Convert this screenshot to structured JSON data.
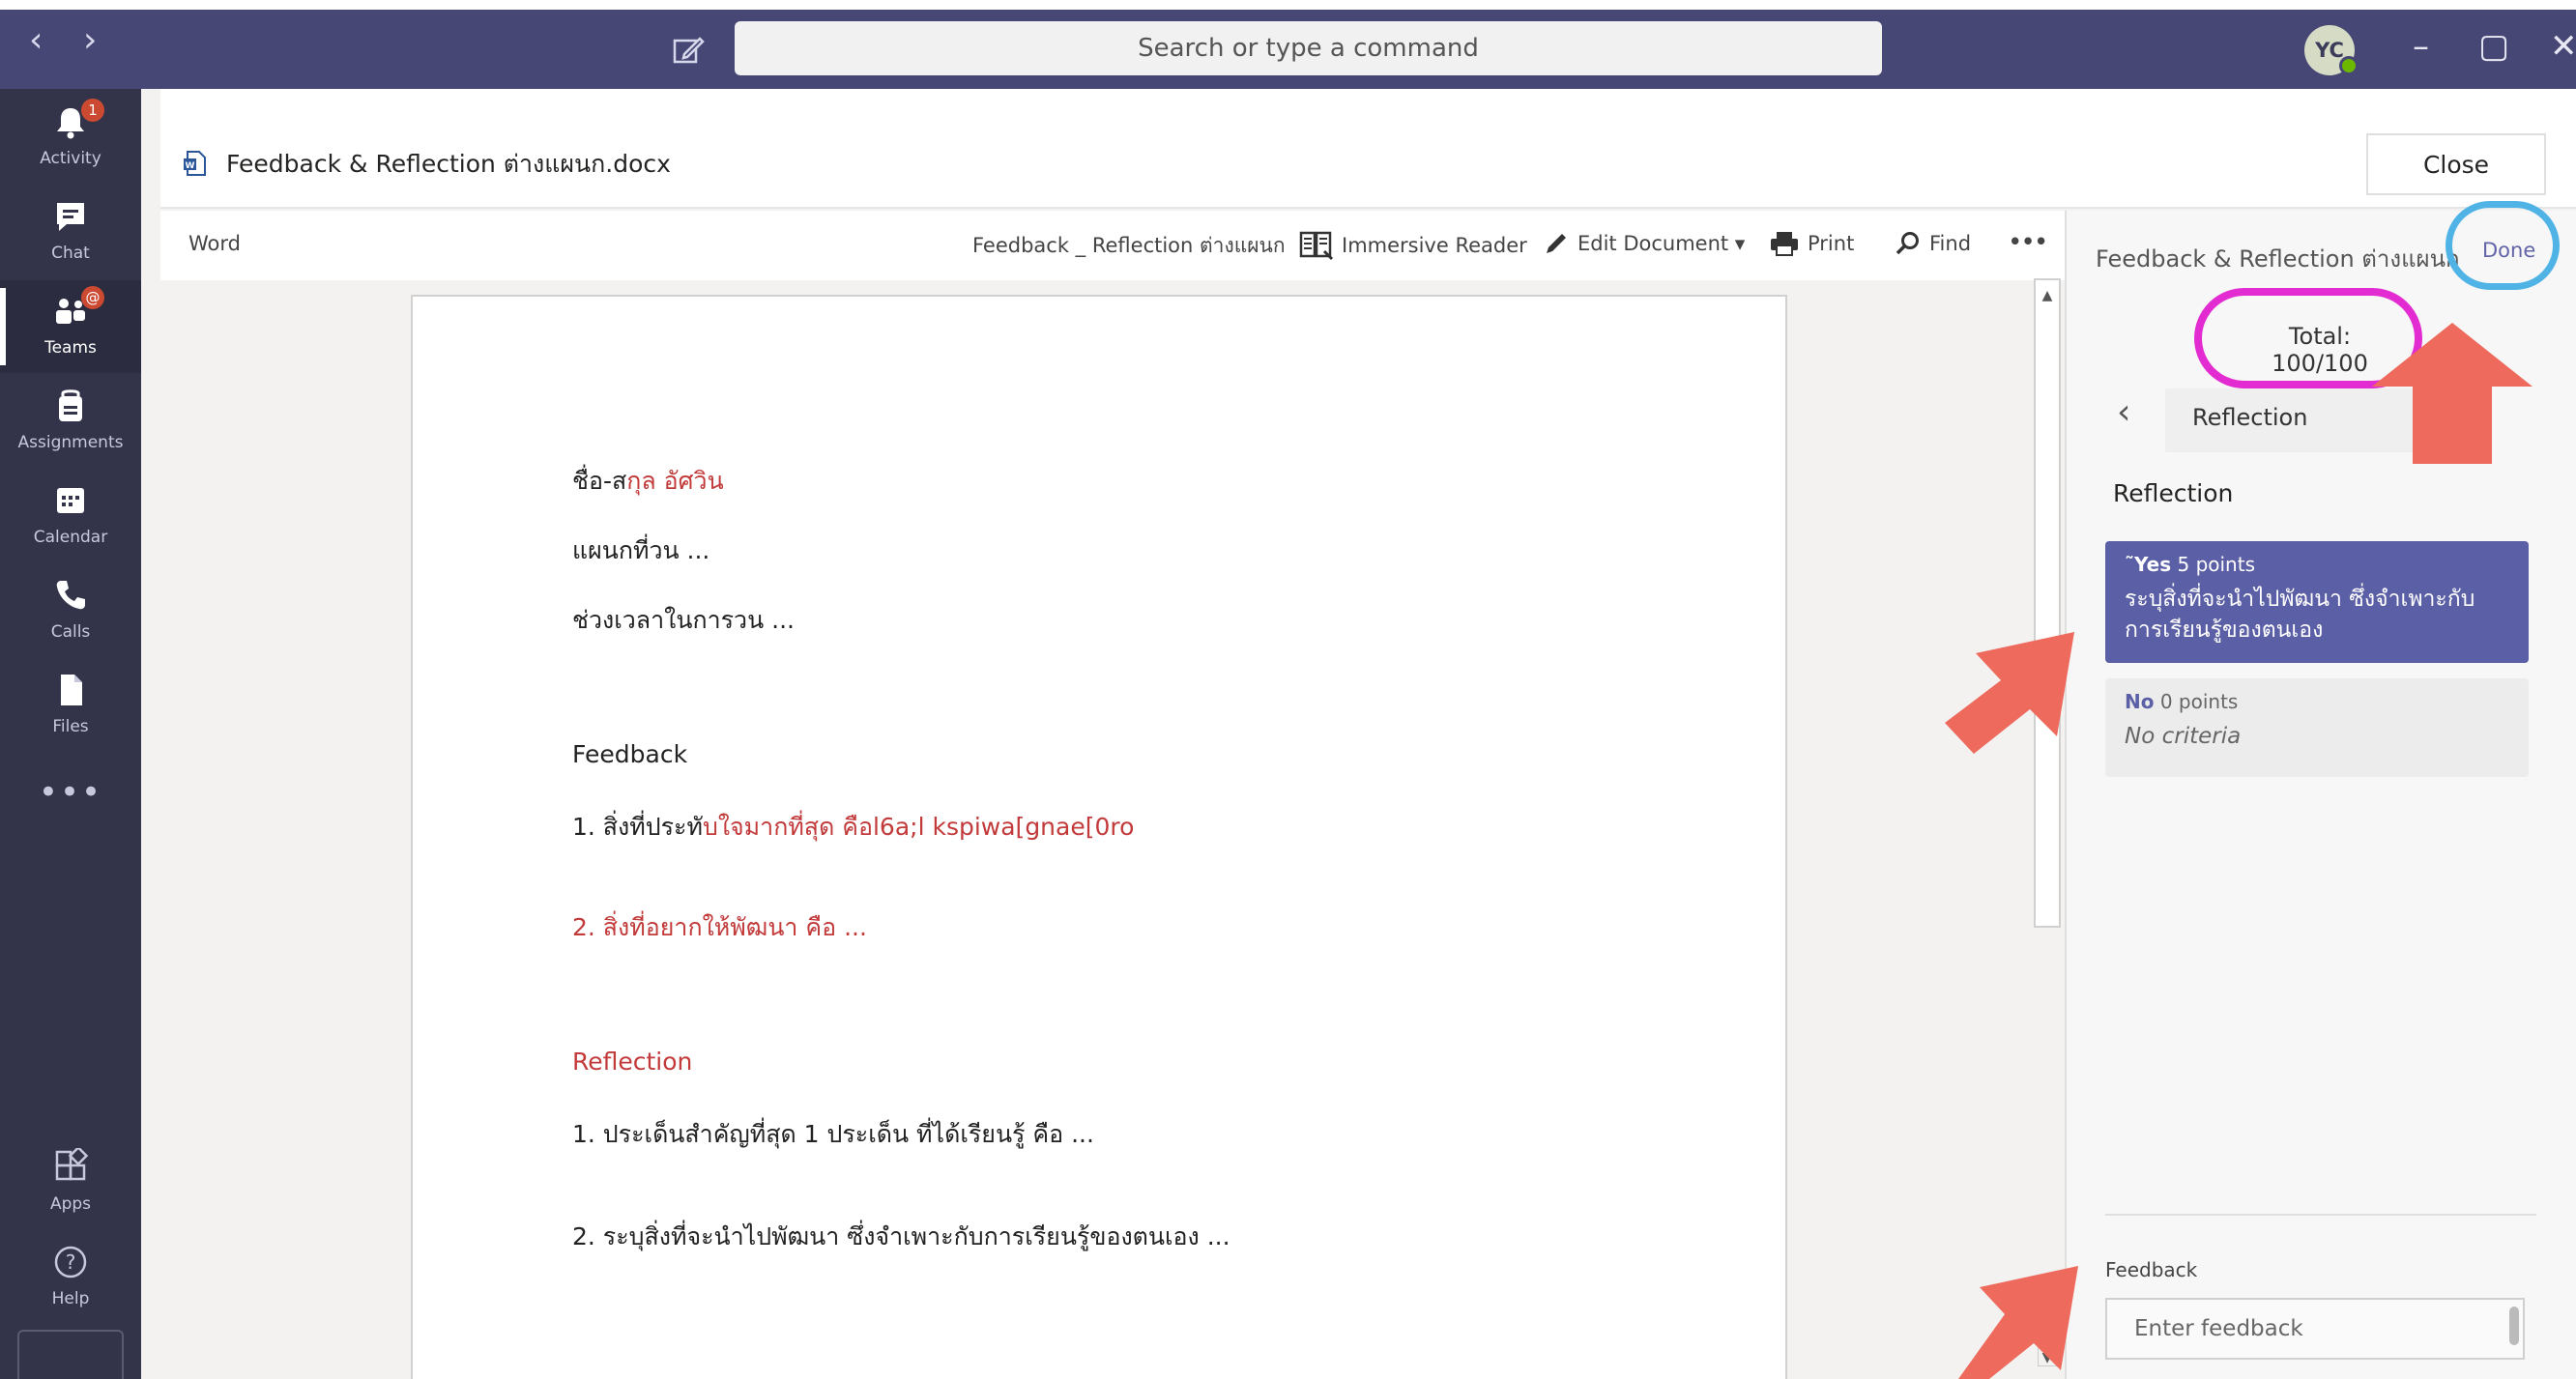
{
  "titlebar": {
    "back_icon": "chevron-left-icon",
    "forward_icon": "chevron-right-icon",
    "search_placeholder": "Search or type a command",
    "avatar_initials": "YC",
    "minimize_glyph": "–",
    "maximize_glyph": "▢",
    "close_glyph": "✕",
    "color": "#464775"
  },
  "rail": {
    "items": [
      {
        "label": "Activity",
        "icon": "bell-icon",
        "badge": "1"
      },
      {
        "label": "Chat",
        "icon": "chat-icon"
      },
      {
        "label": "Teams",
        "icon": "teams-icon",
        "badge": "@"
      },
      {
        "label": "Assignments",
        "icon": "assignments-icon"
      },
      {
        "label": "Calendar",
        "icon": "calendar-icon"
      },
      {
        "label": "Calls",
        "icon": "phone-icon"
      },
      {
        "label": "Files",
        "icon": "file-icon"
      }
    ],
    "more": "•••",
    "apps_label": "Apps",
    "help_label": "Help",
    "color": "#33344a"
  },
  "file": {
    "name": "Feedback & Reflection ต่างแผนก.docx",
    "close_label": "Close"
  },
  "toolbar": {
    "app_label": "Word",
    "doc_title": "Feedback _ Reflection ต่างแผนก",
    "immersive_reader": "Immersive Reader",
    "edit_document": "Edit Document ▾",
    "print": "Print",
    "find": "Find",
    "more": "•••"
  },
  "document": {
    "name_prefix": "ชื่อ-ส",
    "name_value": "กุล อัศวิน",
    "dept": "แผนกที่วน ...",
    "period": "ช่วงเวลาในการวน ...",
    "feedback_heading": "Feedback",
    "fb1_prefix": "1. สิ่งที่ประทั",
    "fb1_value": "บใจมากที่สุด คือl6a;l kspiwa[gnae[0ro",
    "fb2": "2. สิ่งที่อยากให้พัฒนา คือ ...",
    "reflection_heading": "Reflection",
    "ref1": "1. ประเด็นสำคัญที่สุด 1 ประเด็น ที่ได้เรียนรู้ คือ ...",
    "ref2": "2. ระบุสิ่งที่จะนำไปพัฒนา ซึ่งจำเพาะกับการเรียนรู้ของตนเอง ..."
  },
  "panel": {
    "title": "Feedback & Reflection ต่างแผนก",
    "done_label": "Done",
    "total": "Total: 100/100",
    "criterion_selected": "Reflection",
    "criterion_heading": "Reflection",
    "options": [
      {
        "level": "˜Yes",
        "points": "5 points",
        "desc": "ระบุสิ่งที่จะนำไปพัฒนา ซึ่งจำเพาะกับการเรียนรู้ของตนเอง",
        "selected": true
      },
      {
        "level": "No",
        "points": "0 points",
        "desc": "No criteria",
        "selected": false
      }
    ],
    "feedback_label": "Feedback",
    "feedback_placeholder": "Enter feedback",
    "selected_color": "#5b5fa6"
  },
  "annotations": {
    "done_circle_color": "#4fb3e6",
    "total_circle_color": "#e32bd2",
    "arrow_color": "#ee6a5c"
  }
}
